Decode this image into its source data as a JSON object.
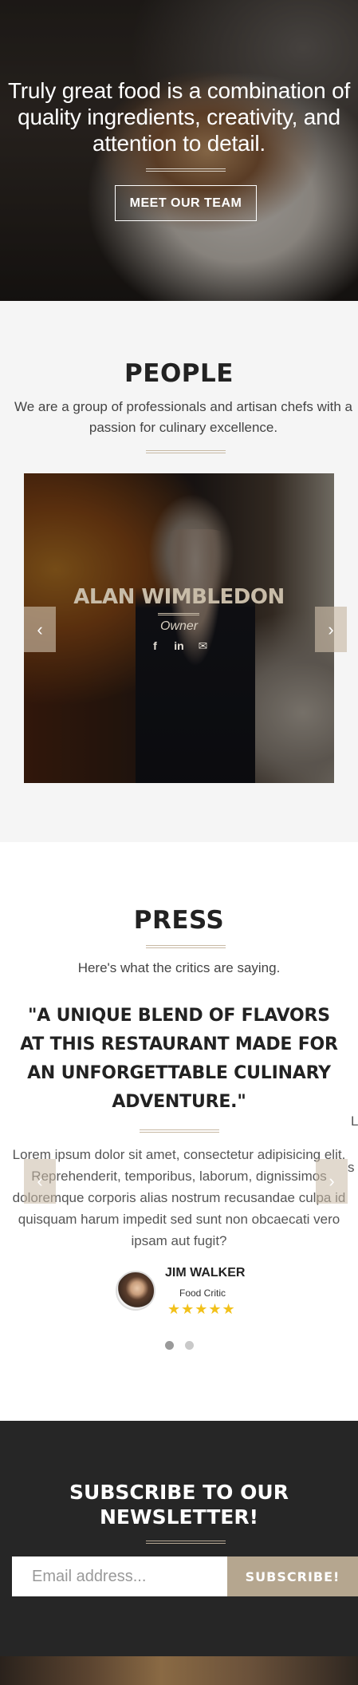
{
  "hero": {
    "quote": "Truly great food is a combination of quality ingredients, creativity, and attention to detail.",
    "button_label": "MEET OUR TEAM"
  },
  "people": {
    "title": "PEOPLE",
    "description": "We are a group of professionals and artisan chefs with a passion for culinary excellence.",
    "member": {
      "name": "ALAN WIMBLEDON",
      "role": "Owner",
      "social": [
        "facebook-icon",
        "linkedin-icon",
        "envelope-icon"
      ],
      "social_glyphs": [
        "f",
        "in",
        "✉"
      ]
    },
    "prev_glyph": "‹",
    "next_glyph": "›"
  },
  "press": {
    "title": "PRESS",
    "subtitle": "Here's what the critics are saying.",
    "quote": "\"A UNIQUE BLEND OF FLAVORS AT THIS RESTAURANT MADE FOR AN UNFORGETTABLE CULINARY ADVENTURE.\"",
    "text": "Lorem ipsum dolor sit amet, consectetur adipisicing elit. Reprehenderit, temporibus, laborum, dignissimos doloremque corporis alias nostrum recusandae culpa id quisquam harum impedit sed sunt non obcaecati vero ipsam aut fugit?",
    "edge_l": "L",
    "edge_s": "s",
    "critic": {
      "name": "JIM WALKER",
      "role": "Food Critic",
      "stars": "★★★★★",
      "rating": 5
    },
    "prev_glyph": "‹",
    "next_glyph": "›",
    "slides": 2,
    "active_slide": 1
  },
  "newsletter": {
    "title": "SUBSCRIBE TO OUR NEWSLETTER!",
    "placeholder": "Email address...",
    "button_label": "SUBSCRIBE!"
  },
  "colors": {
    "accent": "#b5a68f",
    "dark": "#262626",
    "star": "#f2c11b"
  }
}
